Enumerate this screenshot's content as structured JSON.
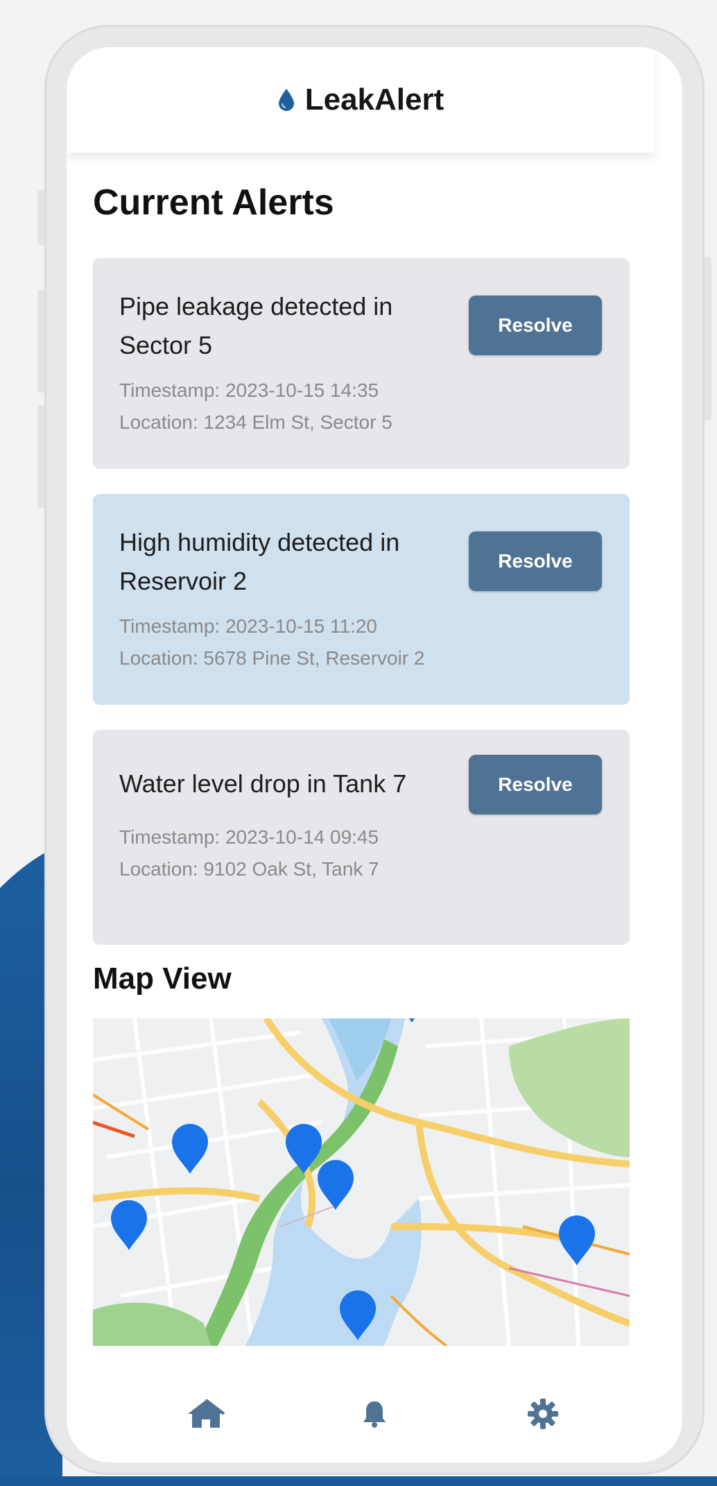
{
  "app": {
    "title": "LeakAlert",
    "icon": "water-drop-icon",
    "accent_color": "#1f5f9e"
  },
  "alerts_section": {
    "title": "Current Alerts",
    "items": [
      {
        "message": "Pipe leakage detected in Sector 5",
        "timestamp": "Timestamp: 2023-10-15 14:35",
        "location": "Location: 1234 Elm St, Sector 5",
        "action_label": "Resolve",
        "highlighted": false,
        "background": "#e7e7eb"
      },
      {
        "message": "High humidity detected in Reservoir 2",
        "timestamp": "Timestamp: 2023-10-15 11:20",
        "location": "Location: 5678 Pine St, Reservoir 2",
        "action_label": "Resolve",
        "highlighted": true,
        "background": "#cfe0ef"
      },
      {
        "message": "Water level drop in Tank 7",
        "timestamp": "Timestamp: 2023-10-14 09:45",
        "location": "Location: 9102 Oak St, Tank 7",
        "action_label": "Resolve",
        "highlighted": false,
        "background": "#e7e7eb"
      }
    ]
  },
  "map_section": {
    "title": "Map View",
    "marker_icon": "map-pin-icon",
    "marker_color": "#1a73e8",
    "marker_count": 6
  },
  "bottom_nav": {
    "items": [
      {
        "name": "home",
        "icon": "home-icon"
      },
      {
        "name": "alerts",
        "icon": "bell-icon"
      },
      {
        "name": "settings",
        "icon": "gear-icon"
      }
    ],
    "icon_color": "#4f7394"
  },
  "colors": {
    "button": "#4f7394",
    "card_default": "#e7e7eb",
    "card_highlight": "#cfe0ef",
    "background_wave": "#1a5a9a"
  }
}
